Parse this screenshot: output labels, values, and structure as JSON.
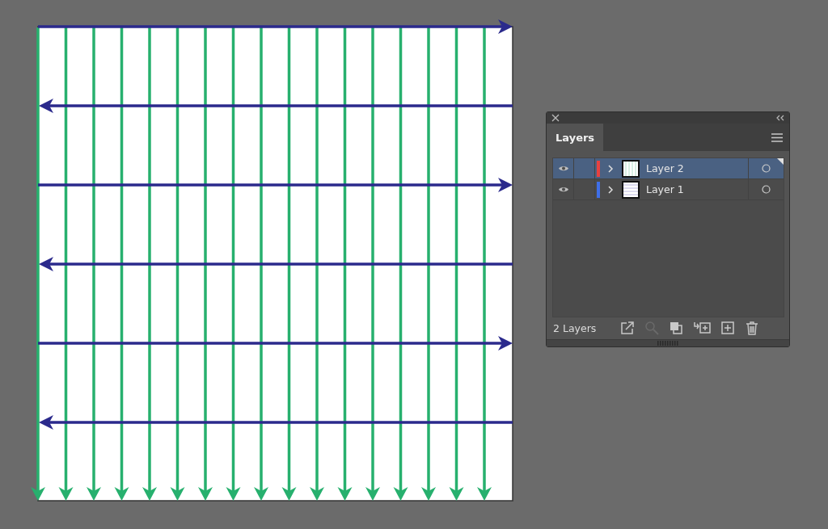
{
  "panel": {
    "tabs": [
      {
        "label": "Layers",
        "selected": true
      }
    ],
    "layers": [
      {
        "name": "Layer 2",
        "visible": true,
        "selected": true,
        "color": "#e8413f"
      },
      {
        "name": "Layer 1",
        "visible": true,
        "selected": false,
        "color": "#3f6fe8"
      }
    ],
    "footer": {
      "count": "2 Layers",
      "buttons": [
        {
          "kind": "export",
          "disabled": false
        },
        {
          "kind": "locate",
          "disabled": true
        },
        {
          "kind": "mask",
          "disabled": false
        },
        {
          "kind": "sublayer",
          "disabled": false
        },
        {
          "kind": "new",
          "disabled": false
        },
        {
          "kind": "delete",
          "disabled": false
        }
      ]
    }
  }
}
